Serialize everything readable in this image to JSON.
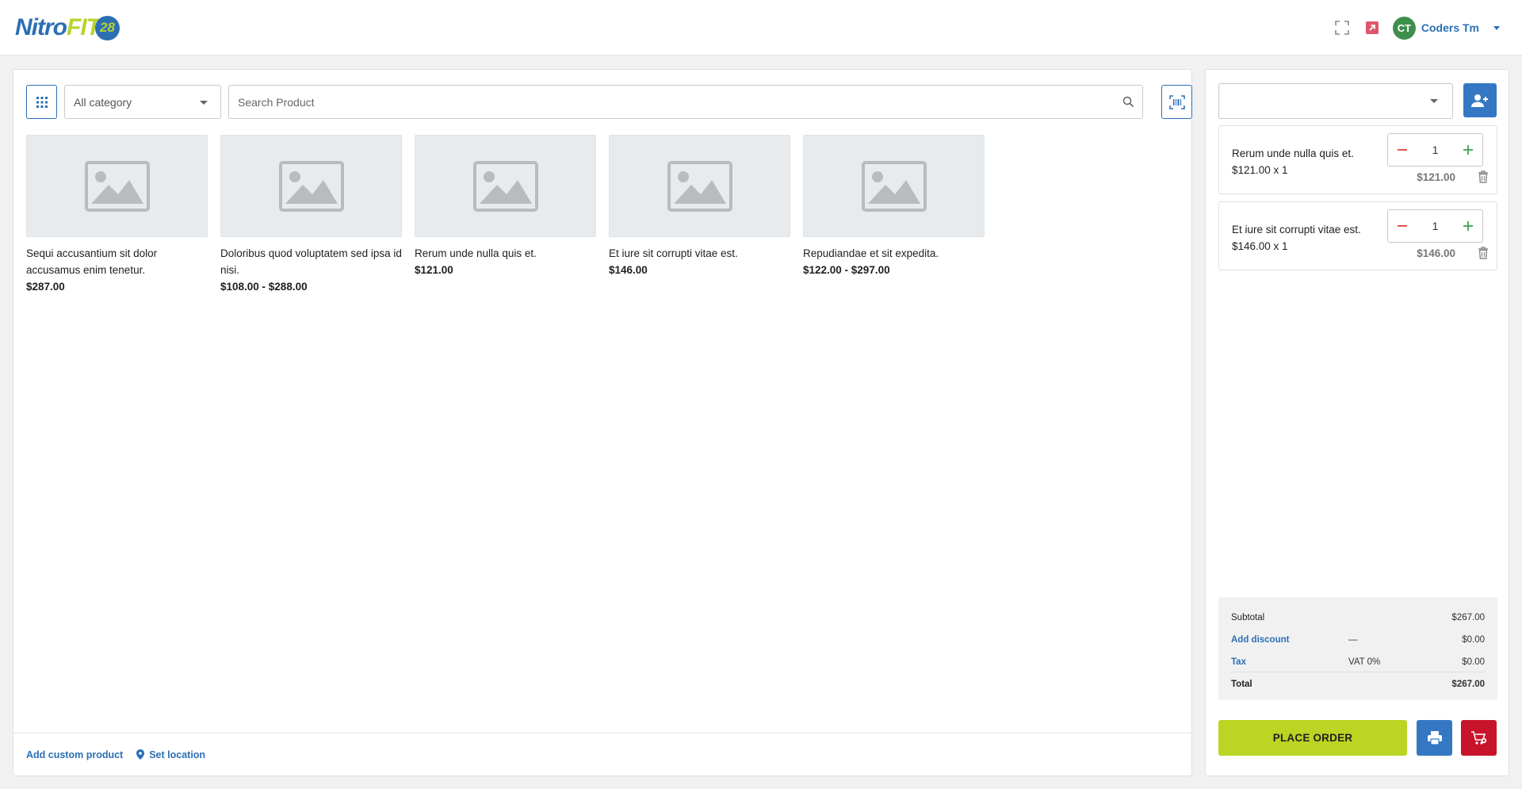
{
  "header": {
    "logo_part1": "Nitro",
    "logo_part2": "FIT",
    "logo_badge": "28",
    "user_initials": "CT",
    "user_name": "Coders Tm"
  },
  "toolbar": {
    "category_selected": "All category",
    "search_placeholder": "Search Product"
  },
  "products": [
    {
      "name": "Sequi accusantium sit dolor accusamus enim tenetur.",
      "price": "$287.00"
    },
    {
      "name": "Doloribus quod voluptatem sed ipsa id nisi.",
      "price": "$108.00 - $288.00"
    },
    {
      "name": "Rerum unde nulla quis et.",
      "price": "$121.00"
    },
    {
      "name": "Et iure sit corrupti vitae est.",
      "price": "$146.00"
    },
    {
      "name": "Repudiandae et sit expedita.",
      "price": "$122.00 - $297.00"
    }
  ],
  "footer": {
    "add_custom": "Add custom product",
    "set_location": "Set location"
  },
  "cart": {
    "customer_selected": "",
    "items": [
      {
        "name": "Rerum unde nulla quis et.",
        "qty_line": "$121.00 x 1",
        "qty": "1",
        "total": "$121.00"
      },
      {
        "name": "Et iure sit corrupti vitae est.",
        "qty_line": "$146.00 x 1",
        "qty": "1",
        "total": "$146.00"
      }
    ],
    "summary": {
      "subtotal_label": "Subtotal",
      "subtotal_value": "$267.00",
      "discount_label": "Add discount",
      "discount_mid": "—",
      "discount_value": "$0.00",
      "tax_label": "Tax",
      "tax_mid": "VAT 0%",
      "tax_value": "$0.00",
      "total_label": "Total",
      "total_value": "$267.00"
    },
    "place_order": "PLACE ORDER"
  },
  "colors": {
    "brand_blue": "#2b6fb5",
    "brand_green": "#bcd523",
    "danger": "#c7142b"
  }
}
